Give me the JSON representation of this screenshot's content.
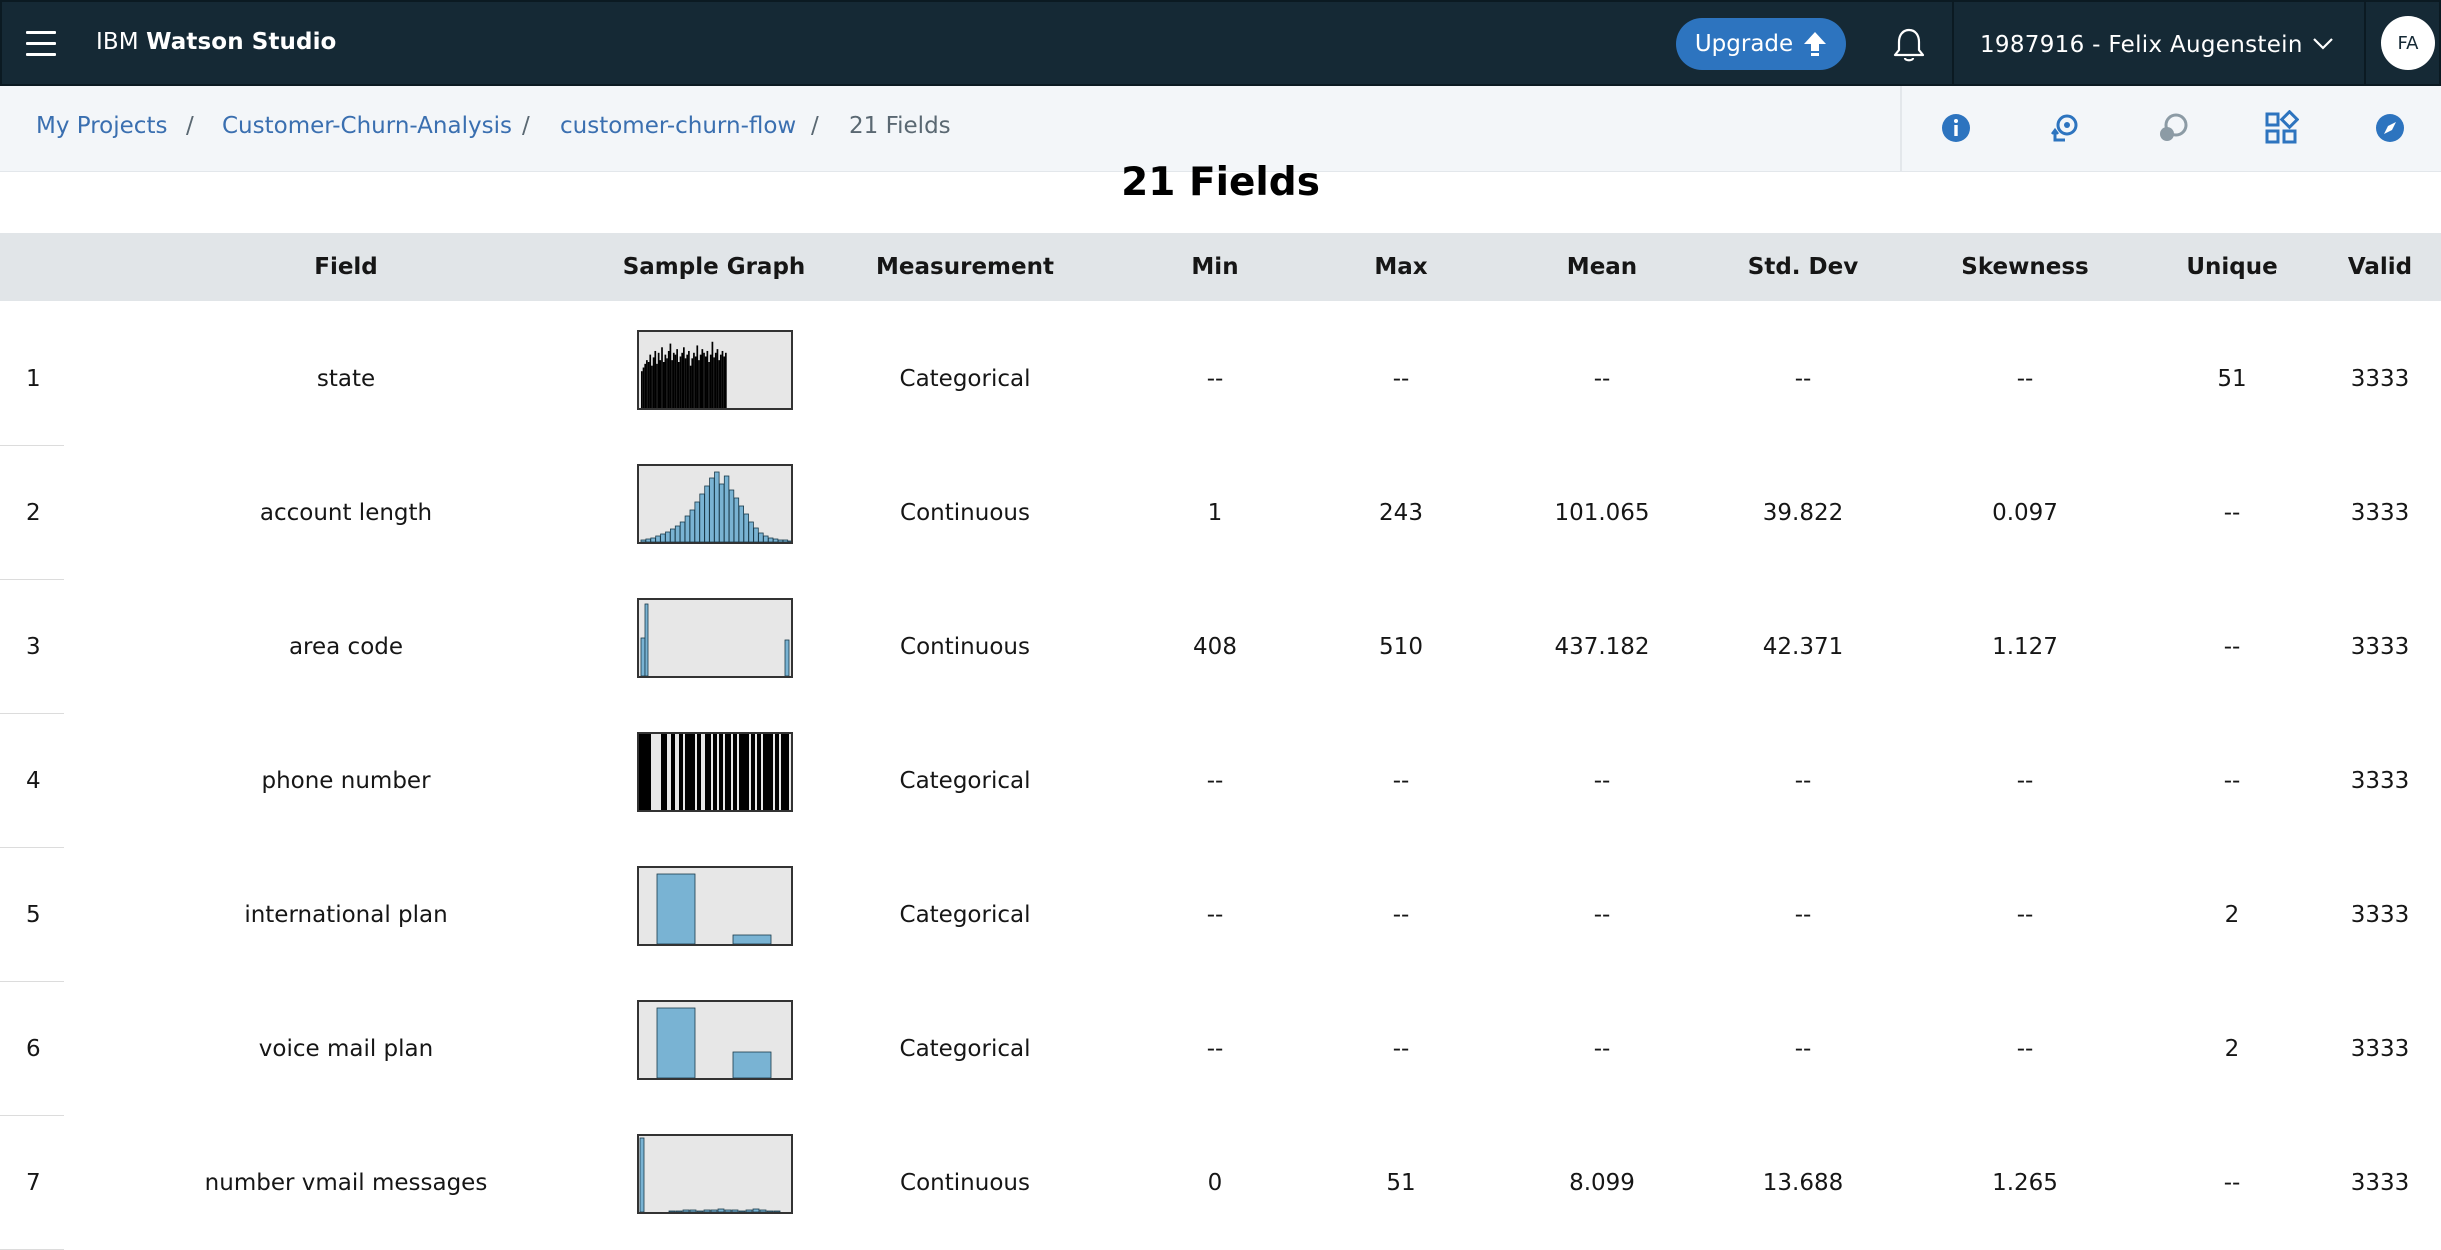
{
  "app": {
    "brand_prefix": "IBM",
    "brand_name": "Watson Studio",
    "upgrade_label": "Upgrade",
    "account_label": "1987916 - Felix Augenstein",
    "avatar_initials": "FA"
  },
  "breadcrumb": {
    "items": [
      "My Projects",
      "Customer-Churn-Analysis",
      "customer-churn-flow",
      "21 Fields"
    ],
    "separator": "/"
  },
  "toolbar_icons": [
    "info-icon",
    "history-icon",
    "comments-icon",
    "grid-icon",
    "compass-icon"
  ],
  "page": {
    "title": "21 Fields"
  },
  "table": {
    "columns": [
      "Field",
      "Sample Graph",
      "Measurement",
      "Min",
      "Max",
      "Mean",
      "Std. Dev",
      "Skewness",
      "Unique",
      "Valid"
    ],
    "rows": [
      {
        "index": "1",
        "field": "state",
        "graph": "state-histogram",
        "measurement": "Categorical",
        "min": "--",
        "max": "--",
        "mean": "--",
        "std": "--",
        "skew": "--",
        "unique": "51",
        "valid": "3333"
      },
      {
        "index": "2",
        "field": "account length",
        "graph": "account-length-histogram",
        "measurement": "Continuous",
        "min": "1",
        "max": "243",
        "mean": "101.065",
        "std": "39.822",
        "skew": "0.097",
        "unique": "--",
        "valid": "3333"
      },
      {
        "index": "3",
        "field": "area code",
        "graph": "area-code-histogram",
        "measurement": "Continuous",
        "min": "408",
        "max": "510",
        "mean": "437.182",
        "std": "42.371",
        "skew": "1.127",
        "unique": "--",
        "valid": "3333"
      },
      {
        "index": "4",
        "field": "phone number",
        "graph": "phone-number-histogram",
        "measurement": "Categorical",
        "min": "--",
        "max": "--",
        "mean": "--",
        "std": "--",
        "skew": "--",
        "unique": "--",
        "valid": "3333"
      },
      {
        "index": "5",
        "field": "international plan",
        "graph": "international-plan-bars",
        "measurement": "Categorical",
        "min": "--",
        "max": "--",
        "mean": "--",
        "std": "--",
        "skew": "--",
        "unique": "2",
        "valid": "3333"
      },
      {
        "index": "6",
        "field": "voice mail plan",
        "graph": "voice-mail-plan-bars",
        "measurement": "Categorical",
        "min": "--",
        "max": "--",
        "mean": "--",
        "std": "--",
        "skew": "--",
        "unique": "2",
        "valid": "3333"
      },
      {
        "index": "7",
        "field": "number vmail messages",
        "graph": "vmail-messages-histogram",
        "measurement": "Continuous",
        "min": "0",
        "max": "51",
        "mean": "8.099",
        "std": "13.688",
        "skew": "1.265",
        "unique": "--",
        "valid": "3333"
      }
    ]
  },
  "colors": {
    "topbar": "#152935",
    "upgrade": "#2d74bf",
    "link": "#3a6fb0",
    "header_row": "#e1e5e8",
    "graph_bar_continuous": "#79b3d3",
    "graph_bar_categorical_dense": "#000000"
  }
}
